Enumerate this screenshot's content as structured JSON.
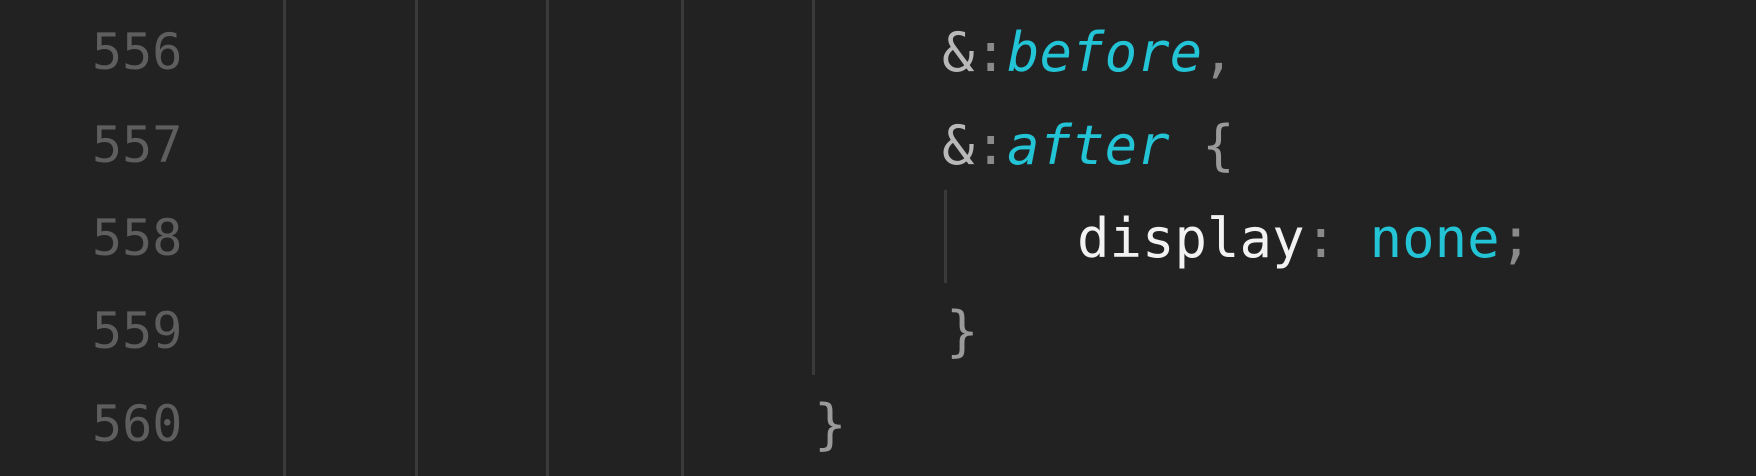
{
  "editor": {
    "lines": [
      {
        "number": "556",
        "tokens": {
          "amp": "&",
          "colon": ":",
          "pseudo": "before",
          "comma": ","
        }
      },
      {
        "number": "557",
        "tokens": {
          "amp": "&",
          "colon": ":",
          "pseudo": "after",
          "brace": "{"
        }
      },
      {
        "number": "558",
        "tokens": {
          "property": "display",
          "colon": ":",
          "value": "none",
          "semicolon": ";"
        }
      },
      {
        "number": "559",
        "tokens": {
          "brace": "}"
        }
      },
      {
        "number": "560",
        "tokens": {
          "brace": "}"
        }
      }
    ]
  },
  "theme": {
    "background": "#222222",
    "line_number": "#5e5e5e",
    "accent_cyan": "#22c4d6",
    "text": "#f2f2f2",
    "punctuation": "#8a8a8a",
    "indent_guide": "#3a3a3a"
  }
}
